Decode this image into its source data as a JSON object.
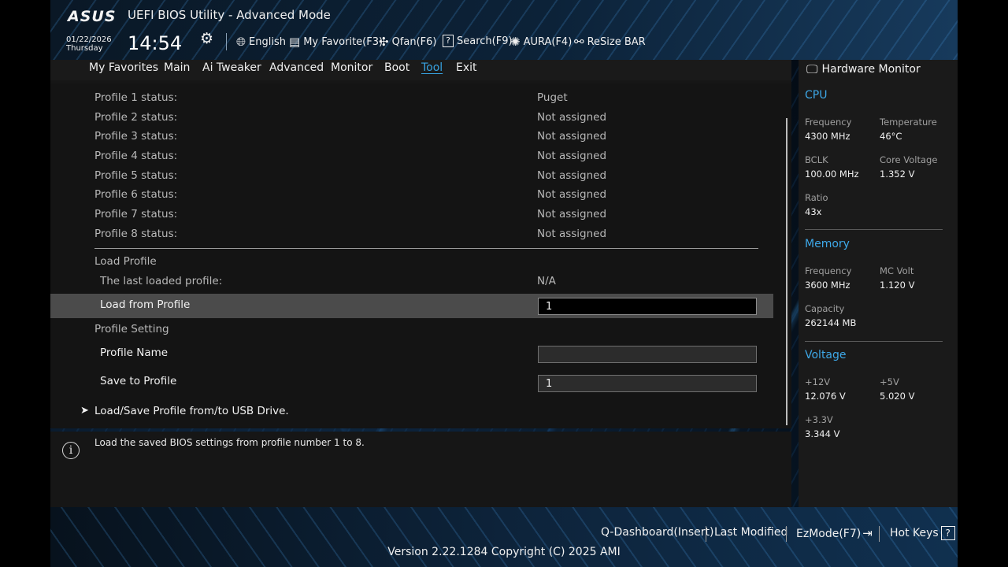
{
  "header": {
    "logo": "ASUS",
    "title": "UEFI BIOS Utility - Advanced Mode",
    "date": "01/22/2026",
    "day": "Thursday",
    "time": "14:54",
    "toolbar": [
      {
        "label": "English",
        "icon": "globe-icon"
      },
      {
        "label": "My Favorite(F3)",
        "icon": "favorite-icon"
      },
      {
        "label": "Qfan(F6)",
        "icon": "fan-icon"
      },
      {
        "label": "Search(F9)",
        "icon": "search-icon"
      },
      {
        "label": "AURA(F4)",
        "icon": "aura-icon"
      },
      {
        "label": "ReSize BAR",
        "icon": "resize-bar-icon"
      }
    ]
  },
  "tabs": [
    "My Favorites",
    "Main",
    "Ai Tweaker",
    "Advanced",
    "Monitor",
    "Boot",
    "Tool",
    "Exit"
  ],
  "active_tab": "Tool",
  "profiles": [
    {
      "label": "Profile 1 status:",
      "value": "Puget"
    },
    {
      "label": "Profile 2 status:",
      "value": "Not assigned"
    },
    {
      "label": "Profile 3 status:",
      "value": "Not assigned"
    },
    {
      "label": "Profile 4 status:",
      "value": "Not assigned"
    },
    {
      "label": "Profile 5 status:",
      "value": "Not assigned"
    },
    {
      "label": "Profile 6 status:",
      "value": "Not assigned"
    },
    {
      "label": "Profile 7 status:",
      "value": "Not assigned"
    },
    {
      "label": "Profile 8 status:",
      "value": "Not assigned"
    }
  ],
  "load_profile": {
    "section": "Load Profile",
    "last_loaded_label": "The last loaded profile:",
    "last_loaded_value": "N/A",
    "load_from_label": "Load from Profile",
    "load_from_value": "1"
  },
  "profile_setting": {
    "section": "Profile Setting",
    "name_label": "Profile Name",
    "name_value": "",
    "save_label": "Save to Profile",
    "save_value": "1"
  },
  "usb_link": "Load/Save Profile from/to USB Drive.",
  "help_text": "Load the saved BIOS settings from profile number 1 to 8.",
  "hardware_monitor": {
    "title": "Hardware Monitor",
    "cpu": {
      "title": "CPU",
      "frequency_label": "Frequency",
      "frequency": "4300 MHz",
      "temperature_label": "Temperature",
      "temperature": "46°C",
      "bclk_label": "BCLK",
      "bclk": "100.00 MHz",
      "core_voltage_label": "Core Voltage",
      "core_voltage": "1.352 V",
      "ratio_label": "Ratio",
      "ratio": "43x"
    },
    "memory": {
      "title": "Memory",
      "frequency_label": "Frequency",
      "frequency": "3600 MHz",
      "mc_volt_label": "MC Volt",
      "mc_volt": "1.120 V",
      "capacity_label": "Capacity",
      "capacity": "262144 MB"
    },
    "voltage": {
      "title": "Voltage",
      "v12_label": "+12V",
      "v12": "12.076 V",
      "v5_label": "+5V",
      "v5": "5.020 V",
      "v33_label": "+3.3V",
      "v33": "3.344 V"
    }
  },
  "footer": {
    "q_dashboard": "Q-Dashboard(Insert)",
    "last_modified": "Last Modified",
    "ezmode": "EzMode(F7)",
    "hot_keys": "Hot Keys",
    "hot_keys_icon": "?",
    "version": "Version 2.22.1284 Copyright (C) 2025 AMI"
  },
  "colors": {
    "accent": "#37a2e0",
    "highlight_row": "#4b4b4b",
    "panel": "#161616"
  }
}
